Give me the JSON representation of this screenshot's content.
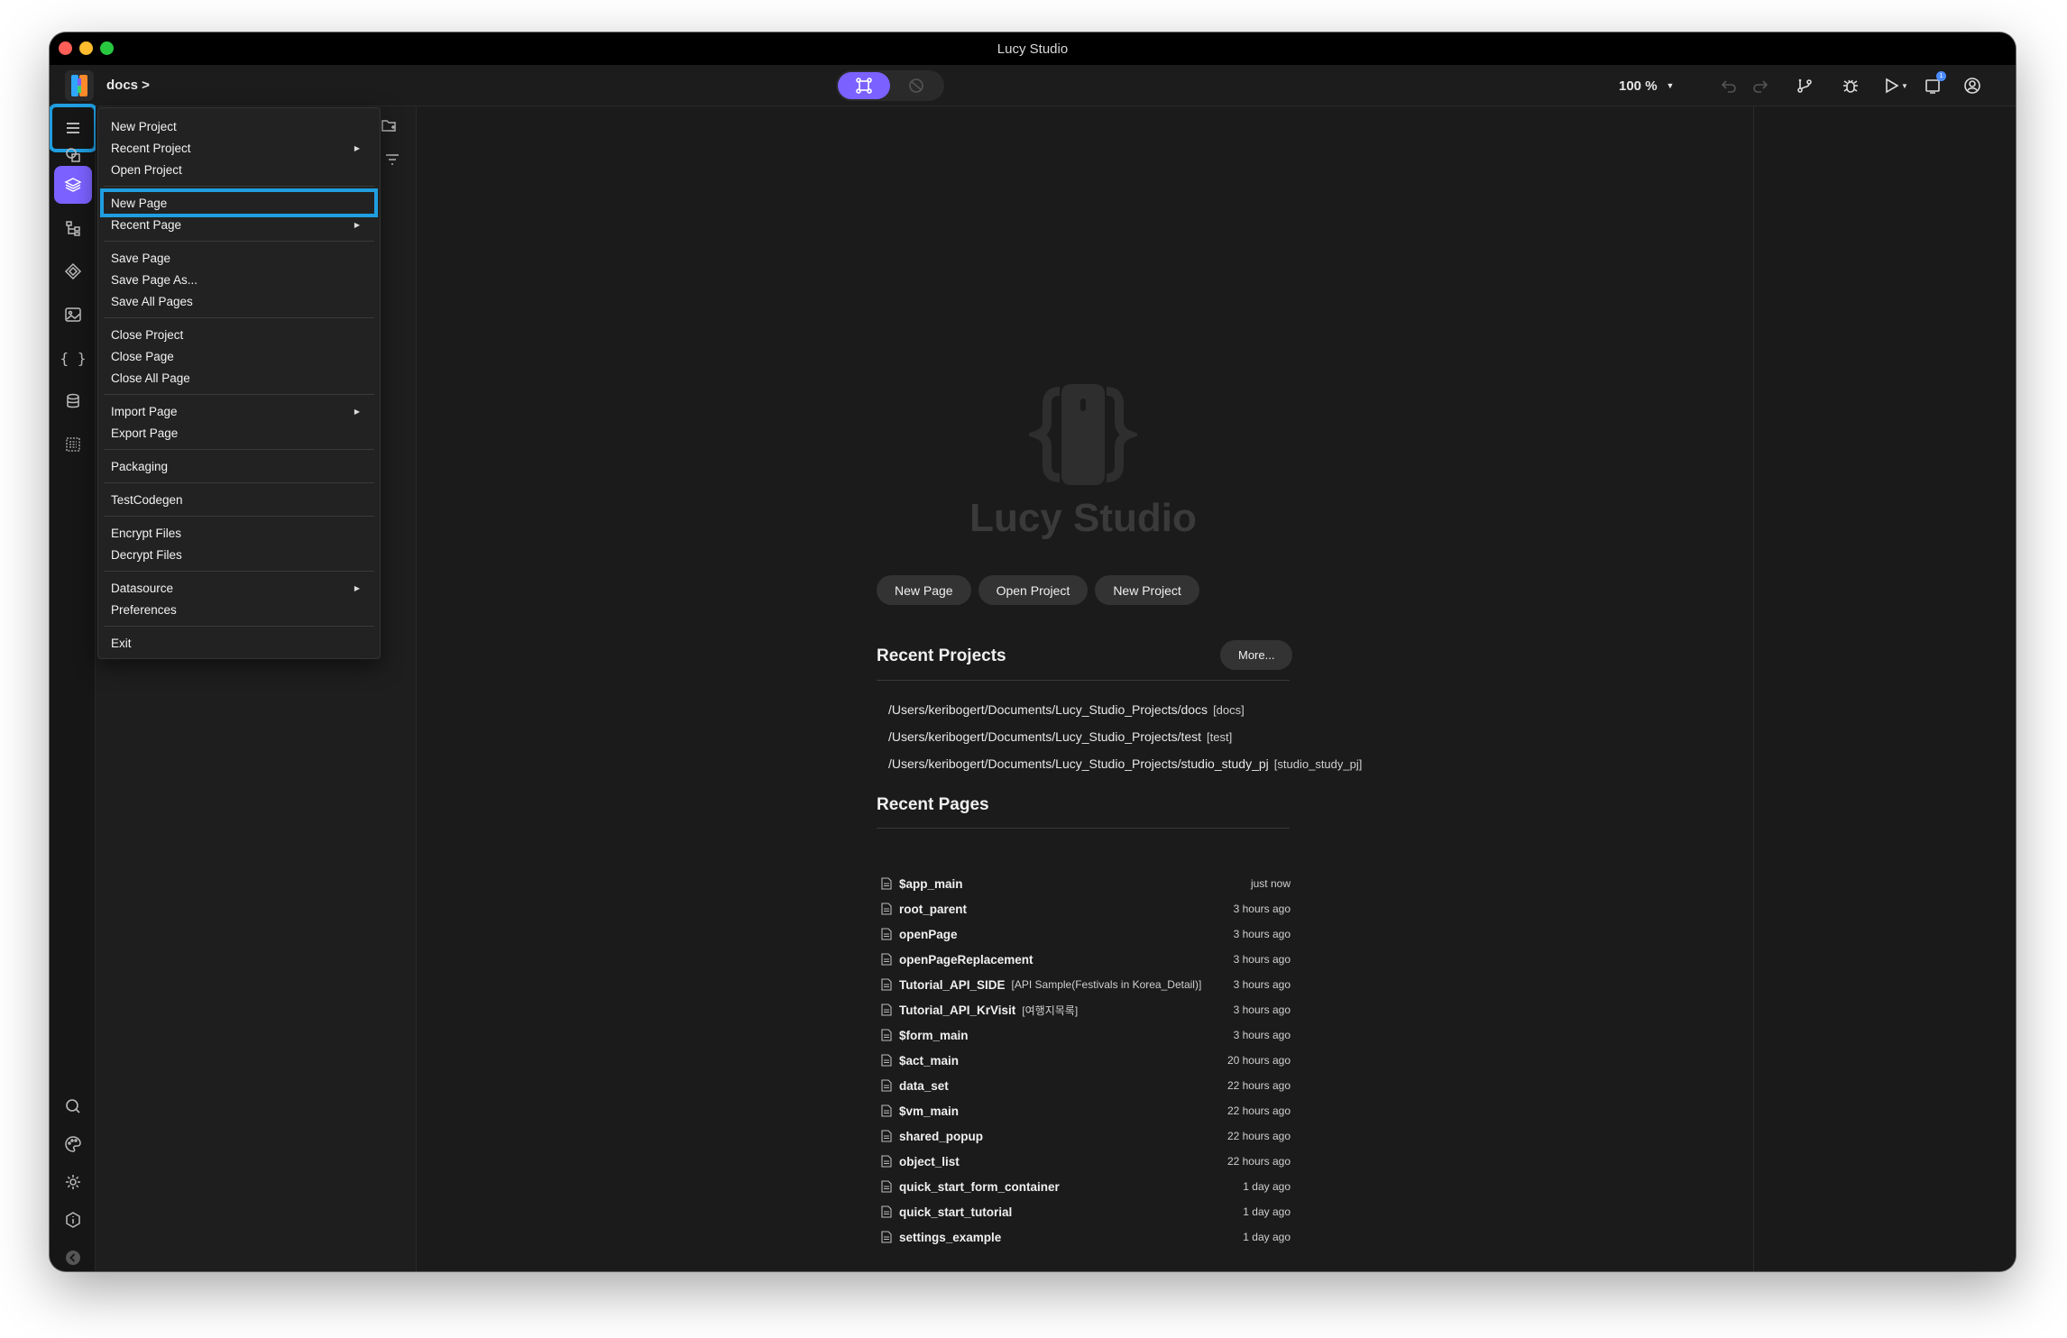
{
  "window": {
    "title": "Lucy Studio",
    "traffic_colors": [
      "#ff5f57",
      "#febc2e",
      "#28c840"
    ]
  },
  "toolbar": {
    "breadcrumb": "docs >",
    "zoom": "100 %",
    "notification_count": "1"
  },
  "icons": {
    "sidebar": [
      "menu-icon",
      "shapes-icon",
      "layers-icon",
      "tree-icon",
      "component-icon",
      "image-icon",
      "braces-icon",
      "database-icon",
      "list-icon",
      "search-icon",
      "palette-icon",
      "gear-icon",
      "info-icon",
      "collapse-icon"
    ],
    "toolbar": [
      "design-mode-icon",
      "preview-mode-icon",
      "undo-icon",
      "redo-icon",
      "git-branch-icon",
      "debug-icon",
      "play-icon",
      "device-icon",
      "account-icon"
    ]
  },
  "colors": {
    "accent": "#7b61ff",
    "highlight": "#1f9ee0"
  },
  "menu": {
    "groups": [
      [
        {
          "label": "New Project"
        },
        {
          "label": "Recent Project",
          "submenu": true
        },
        {
          "label": "Open Project"
        }
      ],
      [
        {
          "label": "New Page",
          "highlight": true
        },
        {
          "label": "Recent Page",
          "submenu": true
        }
      ],
      [
        {
          "label": "Save Page"
        },
        {
          "label": "Save Page As..."
        },
        {
          "label": "Save All Pages"
        }
      ],
      [
        {
          "label": "Close Project"
        },
        {
          "label": "Close Page"
        },
        {
          "label": "Close All Page"
        }
      ],
      [
        {
          "label": "Import Page",
          "submenu": true
        },
        {
          "label": "Export Page"
        }
      ],
      [
        {
          "label": "Packaging"
        }
      ],
      [
        {
          "label": "TestCodegen"
        }
      ],
      [
        {
          "label": "Encrypt Files"
        },
        {
          "label": "Decrypt Files"
        }
      ],
      [
        {
          "label": "Datasource",
          "submenu": true
        },
        {
          "label": "Preferences"
        }
      ],
      [
        {
          "label": "Exit"
        }
      ]
    ]
  },
  "welcome": {
    "brand": "Lucy Studio",
    "buttons": [
      "New Page",
      "Open Project",
      "New Project"
    ],
    "recent_projects_title": "Recent Projects",
    "more_label": "More...",
    "recent_projects": [
      {
        "path": "/Users/keribogert/Documents/Lucy_Studio_Projects/docs",
        "tag": "[docs]"
      },
      {
        "path": "/Users/keribogert/Documents/Lucy_Studio_Projects/test",
        "tag": "[test]"
      },
      {
        "path": "/Users/keribogert/Documents/Lucy_Studio_Projects/studio_study_pj",
        "tag": "[studio_study_pj]"
      }
    ],
    "recent_pages_title": "Recent Pages",
    "recent_pages": [
      {
        "name": "$app_main",
        "tag": "",
        "time": "just now"
      },
      {
        "name": "root_parent",
        "tag": "",
        "time": "3 hours ago"
      },
      {
        "name": "openPage",
        "tag": "",
        "time": "3 hours ago"
      },
      {
        "name": "openPageReplacement",
        "tag": "",
        "time": "3 hours ago"
      },
      {
        "name": "Tutorial_API_SIDE",
        "tag": "[API Sample(Festivals in Korea_Detail)]",
        "time": "3 hours ago"
      },
      {
        "name": "Tutorial_API_KrVisit",
        "tag": "[여행지목록]",
        "time": "3 hours ago"
      },
      {
        "name": "$form_main",
        "tag": "",
        "time": "3 hours ago"
      },
      {
        "name": "$act_main",
        "tag": "",
        "time": "20 hours ago"
      },
      {
        "name": "data_set",
        "tag": "",
        "time": "22 hours ago"
      },
      {
        "name": "$vm_main",
        "tag": "",
        "time": "22 hours ago"
      },
      {
        "name": "shared_popup",
        "tag": "",
        "time": "22 hours ago"
      },
      {
        "name": "object_list",
        "tag": "",
        "time": "22 hours ago"
      },
      {
        "name": "quick_start_form_container",
        "tag": "",
        "time": "1 day ago"
      },
      {
        "name": "quick_start_tutorial",
        "tag": "",
        "time": "1 day ago"
      },
      {
        "name": "settings_example",
        "tag": "",
        "time": "1 day ago"
      }
    ]
  }
}
